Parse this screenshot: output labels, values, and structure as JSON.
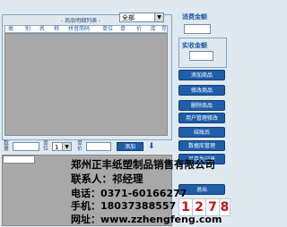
{
  "list_panel": {
    "title": "- 商品明细列表 -",
    "filter_value": "全部",
    "columns": [
      "类",
      "别",
      "名",
      "称",
      "拼音简码",
      "单位",
      "单",
      "价",
      "库",
      "存"
    ]
  },
  "summary": {
    "consume_label": "消费金额",
    "actual_label": "实收金额"
  },
  "buttons": [
    "添加商品",
    "修改商品",
    "删除商品",
    "用户管理修改",
    "结账后",
    "数据库管理",
    "另存为记录",
    "退出"
  ],
  "entry_row": {
    "qty_label": "数量",
    "unit_label": "单位",
    "price_label": "单价",
    "unit_value": "1",
    "add_button": "添加"
  },
  "overlay": {
    "company": "郑州正丰纸塑制品销售有限公司",
    "contact": "联系人：祁经理",
    "phone": "电话：0371-60166277",
    "mobile": "手机：18037388557",
    "website": "网址：www.zzhengfeng.com",
    "digits": [
      "1",
      "2",
      "7",
      "8"
    ]
  },
  "colors": {
    "accent": "#1f5ea8",
    "background": "#dfe9ef",
    "grid": "#a8a8a8",
    "digit_red": "#c31414"
  }
}
